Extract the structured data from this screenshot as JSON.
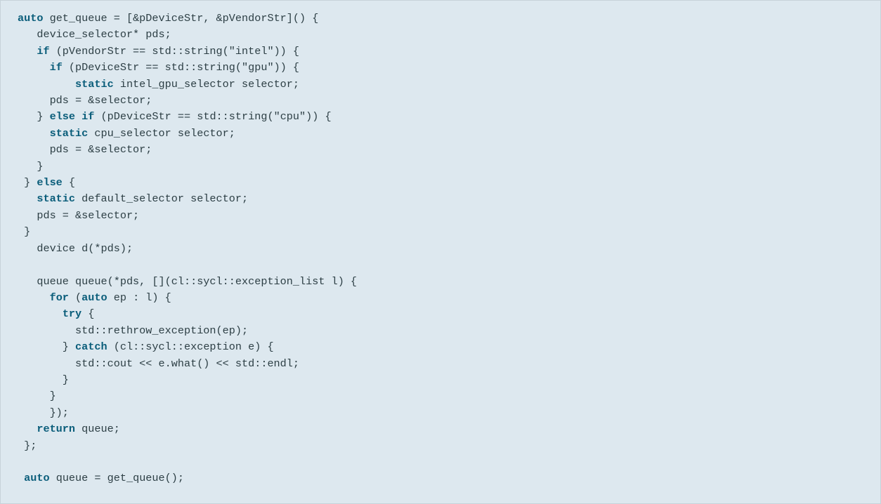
{
  "code": {
    "tokens": [
      {
        "cls": "kw",
        "t": "auto"
      },
      {
        "t": " get_queue = [&pDeviceStr, &pVendorStr]() {\n"
      },
      {
        "t": "   device_selector* pds;\n"
      },
      {
        "t": "   "
      },
      {
        "cls": "kw",
        "t": "if"
      },
      {
        "t": " (pVendorStr == std::string(\"intel\")) {\n"
      },
      {
        "t": "     "
      },
      {
        "cls": "kw",
        "t": "if"
      },
      {
        "t": " (pDeviceStr == std::string(\"gpu\")) {\n"
      },
      {
        "t": "         "
      },
      {
        "cls": "kw",
        "t": "static"
      },
      {
        "t": " intel_gpu_selector selector;\n"
      },
      {
        "t": "     pds = &selector;\n"
      },
      {
        "t": "   } "
      },
      {
        "cls": "kw",
        "t": "else if"
      },
      {
        "t": " (pDeviceStr == std::string(\"cpu\")) {\n"
      },
      {
        "t": "     "
      },
      {
        "cls": "kw",
        "t": "static"
      },
      {
        "t": " cpu_selector selector;\n"
      },
      {
        "t": "     pds = &selector;\n"
      },
      {
        "t": "   }\n"
      },
      {
        "t": " } "
      },
      {
        "cls": "kw",
        "t": "else"
      },
      {
        "t": " {\n"
      },
      {
        "t": "   "
      },
      {
        "cls": "kw",
        "t": "static"
      },
      {
        "t": " default_selector selector;\n"
      },
      {
        "t": "   pds = &selector;\n"
      },
      {
        "t": " }\n"
      },
      {
        "t": "   device d(*pds);\n"
      },
      {
        "t": "\n"
      },
      {
        "t": "   queue queue(*pds, [](cl::sycl::exception_list l) {\n"
      },
      {
        "t": "     "
      },
      {
        "cls": "kw",
        "t": "for"
      },
      {
        "t": " ("
      },
      {
        "cls": "kw",
        "t": "auto"
      },
      {
        "t": " ep : l) {\n"
      },
      {
        "t": "       "
      },
      {
        "cls": "kw",
        "t": "try"
      },
      {
        "t": " {\n"
      },
      {
        "t": "         std::rethrow_exception(ep);\n"
      },
      {
        "t": "       } "
      },
      {
        "cls": "kw",
        "t": "catch"
      },
      {
        "t": " (cl::sycl::exception e) {\n"
      },
      {
        "t": "         std::cout << e.what() << std::endl;\n"
      },
      {
        "t": "       }\n"
      },
      {
        "t": "     }\n"
      },
      {
        "t": "     });\n"
      },
      {
        "t": "   "
      },
      {
        "cls": "kw",
        "t": "return"
      },
      {
        "t": " queue;\n"
      },
      {
        "t": " };\n"
      },
      {
        "t": "\n"
      },
      {
        "t": " "
      },
      {
        "cls": "kw",
        "t": "auto"
      },
      {
        "t": " queue = get_queue();"
      }
    ]
  }
}
